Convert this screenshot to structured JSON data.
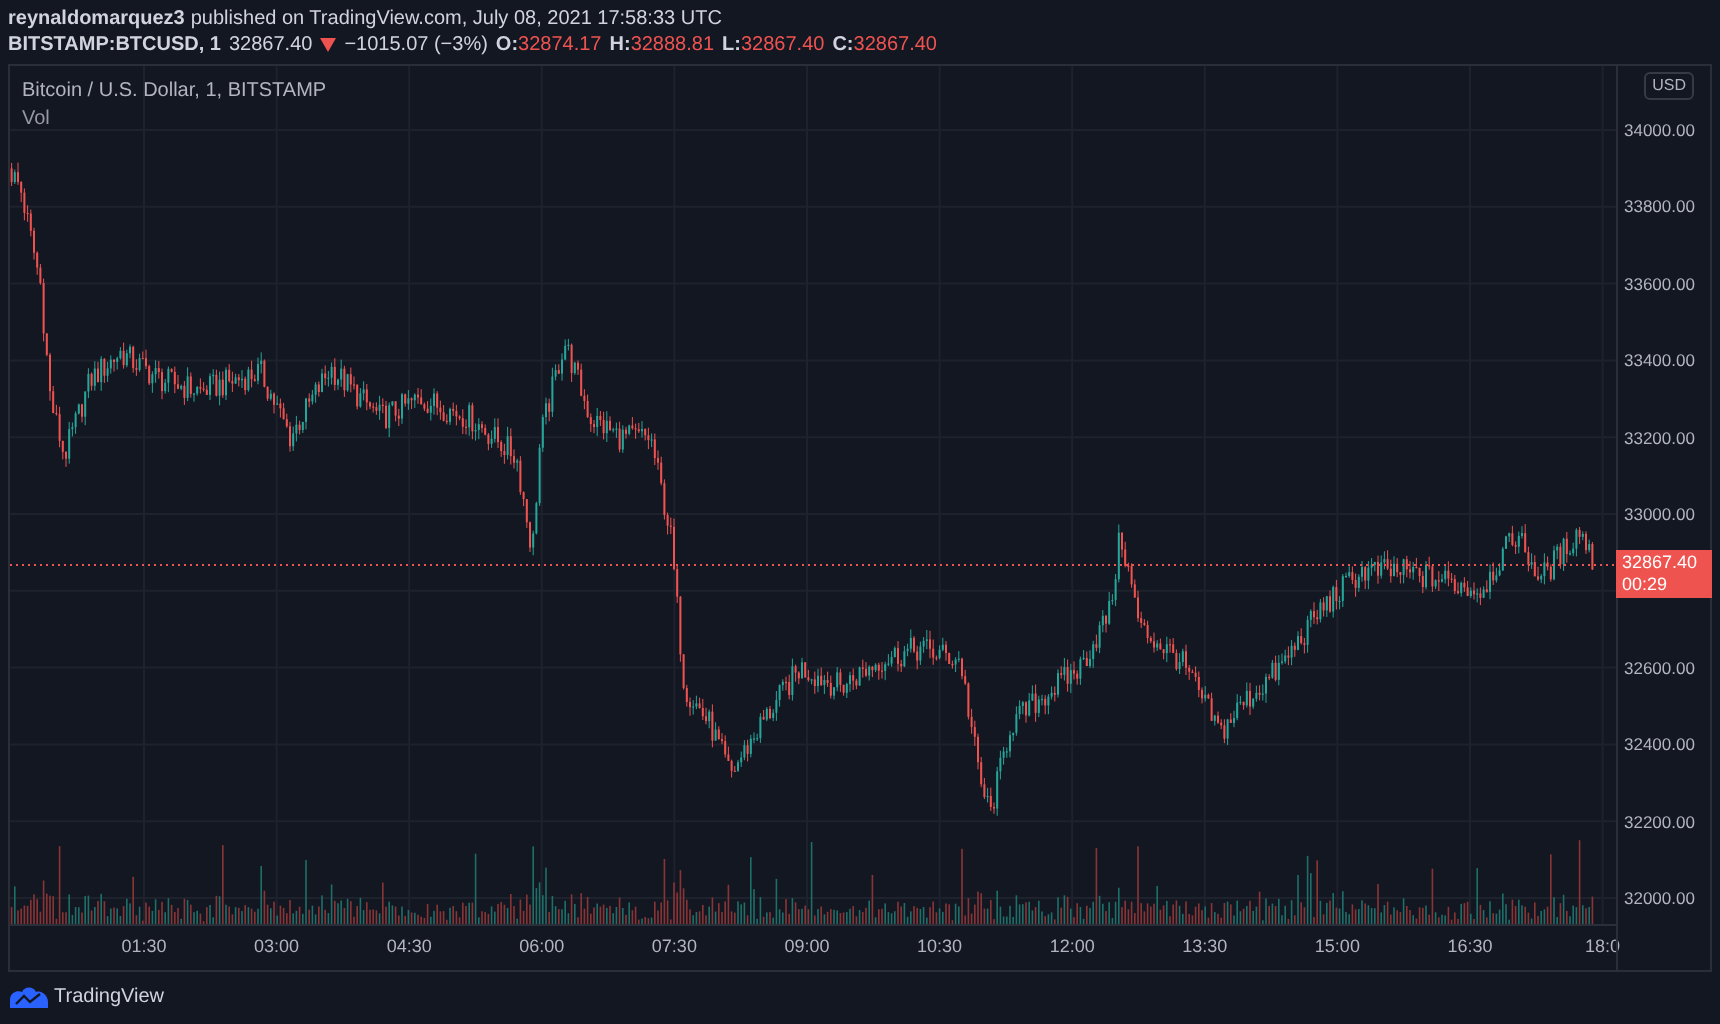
{
  "header": {
    "author": "reynaldomarquez3",
    "published": "published on TradingView.com, July 08, 2021 17:58:33 UTC"
  },
  "symbol": {
    "name": "BITSTAMP:BTCUSD, 1",
    "last": "32867.40",
    "down": true,
    "change": "−1015.07 (−3%)",
    "ohlc": [
      {
        "label": "O:",
        "value": "32874.17"
      },
      {
        "label": "H:",
        "value": "32888.81"
      },
      {
        "label": "L:",
        "value": "32867.40"
      },
      {
        "label": "C:",
        "value": "32867.40"
      }
    ]
  },
  "chart": {
    "legend_title": "Bitcoin / U.S. Dollar, 1, BITSTAMP",
    "volume_label": "Vol",
    "currency": "USD",
    "price_ticks_upper": [
      "34000.00",
      "33800.00",
      "33600.00",
      "33400.00",
      "33200.00",
      "33000.00"
    ],
    "price_ticks_lower": [
      "32600.00",
      "32400.00",
      "32200.00",
      "32000.00"
    ],
    "time_ticks": [
      "01:30",
      "03:00",
      "04:30",
      "06:00",
      "07:30",
      "09:00",
      "10:30",
      "12:00",
      "13:30",
      "15:00",
      "16:30",
      "18:0"
    ],
    "price_tag": {
      "price": "32867.40",
      "countdown": "00:29"
    }
  },
  "brand": "TradingView"
}
